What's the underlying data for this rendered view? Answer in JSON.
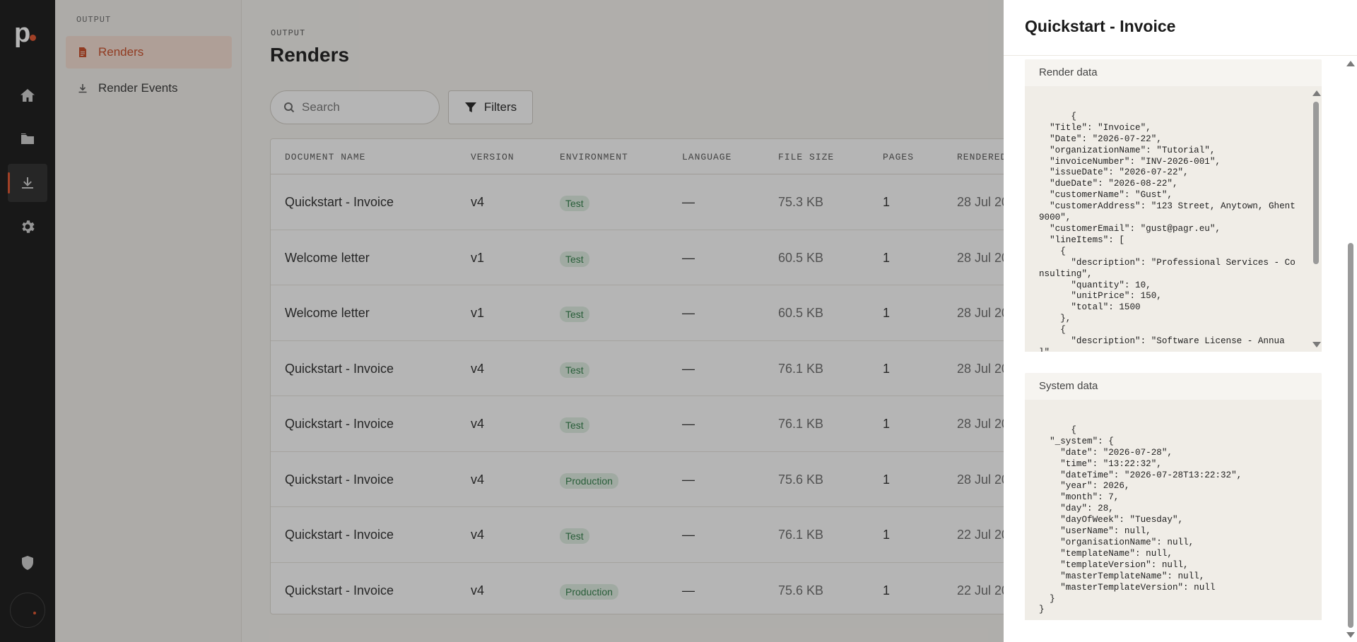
{
  "app": {
    "logo_text": "p",
    "accent": "#e2512a"
  },
  "rail": {
    "items": [
      {
        "name": "home-icon"
      },
      {
        "name": "folder-icon"
      },
      {
        "name": "download-icon",
        "active": true
      },
      {
        "name": "gear-icon"
      },
      {
        "name": "shield-icon"
      }
    ]
  },
  "subnav": {
    "title": "OUTPUT",
    "items": [
      {
        "label": "Renders",
        "active": true
      },
      {
        "label": "Render Events"
      }
    ]
  },
  "main": {
    "eyebrow": "OUTPUT",
    "title": "Renders",
    "search": {
      "placeholder": "Search",
      "value": ""
    },
    "filters_label": "Filters",
    "columns": [
      "DOCUMENT NAME",
      "VERSION",
      "ENVIRONMENT",
      "LANGUAGE",
      "FILE SIZE",
      "PAGES",
      "RENDERED"
    ],
    "rows": [
      {
        "name": "Quickstart - Invoice",
        "version": "v4",
        "env": "Test",
        "language": "—",
        "size": "75.3 KB",
        "pages": "1",
        "rendered": "28 Jul 20"
      },
      {
        "name": "Welcome letter",
        "version": "v1",
        "env": "Test",
        "language": "—",
        "size": "60.5 KB",
        "pages": "1",
        "rendered": "28 Jul 20"
      },
      {
        "name": "Welcome letter",
        "version": "v1",
        "env": "Test",
        "language": "—",
        "size": "60.5 KB",
        "pages": "1",
        "rendered": "28 Jul 20"
      },
      {
        "name": "Quickstart - Invoice",
        "version": "v4",
        "env": "Test",
        "language": "—",
        "size": "76.1 KB",
        "pages": "1",
        "rendered": "28 Jul 20"
      },
      {
        "name": "Quickstart - Invoice",
        "version": "v4",
        "env": "Test",
        "language": "—",
        "size": "76.1 KB",
        "pages": "1",
        "rendered": "28 Jul 20"
      },
      {
        "name": "Quickstart - Invoice",
        "version": "v4",
        "env": "Production",
        "language": "—",
        "size": "75.6 KB",
        "pages": "1",
        "rendered": "28 Jul 20"
      },
      {
        "name": "Quickstart - Invoice",
        "version": "v4",
        "env": "Test",
        "language": "—",
        "size": "76.1 KB",
        "pages": "1",
        "rendered": "22 Jul 20"
      },
      {
        "name": "Quickstart - Invoice",
        "version": "v4",
        "env": "Production",
        "language": "—",
        "size": "75.6 KB",
        "pages": "1",
        "rendered": "22 Jul 20"
      }
    ]
  },
  "drawer": {
    "title": "Quickstart - Invoice",
    "render_label": "Render data",
    "render_code": "{\n  \"Title\": \"Invoice\",\n  \"Date\": \"2026-07-22\",\n  \"organizationName\": \"Tutorial\",\n  \"invoiceNumber\": \"INV-2026-001\",\n  \"issueDate\": \"2026-07-22\",\n  \"dueDate\": \"2026-08-22\",\n  \"customerName\": \"Gust\",\n  \"customerAddress\": \"123 Street, Anytown, Ghent 9000\",\n  \"customerEmail\": \"gust@pagr.eu\",\n  \"lineItems\": [\n    {\n      \"description\": \"Professional Services - Consulting\",\n      \"quantity\": 10,\n      \"unitPrice\": 150,\n      \"total\": 1500\n    },\n    {\n      \"description\": \"Software License - Annual\",",
    "system_label": "System data",
    "system_code": "{\n  \"_system\": {\n    \"date\": \"2026-07-28\",\n    \"time\": \"13:22:32\",\n    \"dateTime\": \"2026-07-28T13:22:32\",\n    \"year\": 2026,\n    \"month\": 7,\n    \"day\": 28,\n    \"dayOfWeek\": \"Tuesday\",\n    \"userName\": null,\n    \"organisationName\": null,\n    \"templateName\": null,\n    \"templateVersion\": null,\n    \"masterTemplateName\": null,\n    \"masterTemplateVersion\": null\n  }\n}"
  }
}
